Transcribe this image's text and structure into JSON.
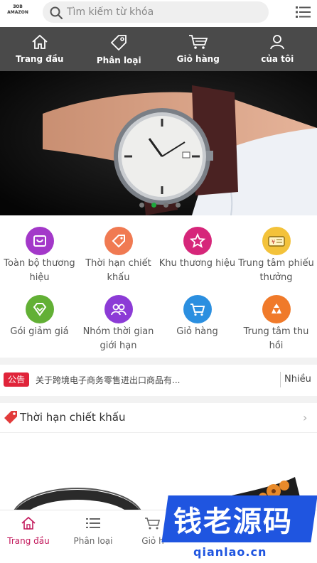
{
  "header": {
    "logo_lines": [
      "ƎOB",
      "AMAZON"
    ],
    "search_placeholder": "Tìm kiếm từ khóa"
  },
  "top_nav": [
    {
      "label": "Trang đầu",
      "icon": "home-icon"
    },
    {
      "label": "Phân loại",
      "icon": "tag-icon"
    },
    {
      "label": "Giỏ hàng",
      "icon": "cart-icon"
    },
    {
      "label": "của tôi",
      "icon": "user-icon"
    }
  ],
  "banner": {
    "slide_count": 4,
    "active_slide": 2
  },
  "categories": [
    {
      "label": "Toàn bộ thương hiệu",
      "icon": "bag-icon",
      "color": "#a338c9"
    },
    {
      "label": "Thời hạn chiết khấu",
      "icon": "price-tag-icon",
      "color": "#f07a52"
    },
    {
      "label": "Khu thương hiệu",
      "icon": "star-icon",
      "color": "#d6267a"
    },
    {
      "label": "Trung tâm phiếu thưởng",
      "icon": "coupon-icon",
      "color": "#f3c23a"
    },
    {
      "label": "Gói giảm giá",
      "icon": "diamond-icon",
      "color": "#62b035"
    },
    {
      "label": "Nhóm thời gian giới hạn",
      "icon": "group-icon",
      "color": "#8c3bd6"
    },
    {
      "label": "Giỏ hàng",
      "icon": "cart-icon",
      "color": "#2b8fe0"
    },
    {
      "label": "Trung tâm thu hồi",
      "icon": "recycle-icon",
      "color": "#f07a2a"
    }
  ],
  "announcement": {
    "tag": "公告",
    "text": "关于跨境电子商务零售进出口商品有...",
    "more": "Nhiều"
  },
  "discount_section": {
    "title": "Thời hạn chiết khấu",
    "chevron": "›"
  },
  "bottom_tabs": [
    {
      "label": "Trang đầu",
      "icon": "home-icon",
      "active": true
    },
    {
      "label": "Phân loại",
      "icon": "list-icon",
      "active": false
    },
    {
      "label": "Giỏ h",
      "icon": "cart-icon",
      "active": false
    }
  ],
  "watermark": {
    "big": "钱老源码",
    "small": "qianlao.cn"
  },
  "colors": {
    "accent": "#c2185b",
    "dark_nav": "#4a4a4a",
    "announce_tag": "#e0243a",
    "watermark_blue": "#1f55e0"
  }
}
